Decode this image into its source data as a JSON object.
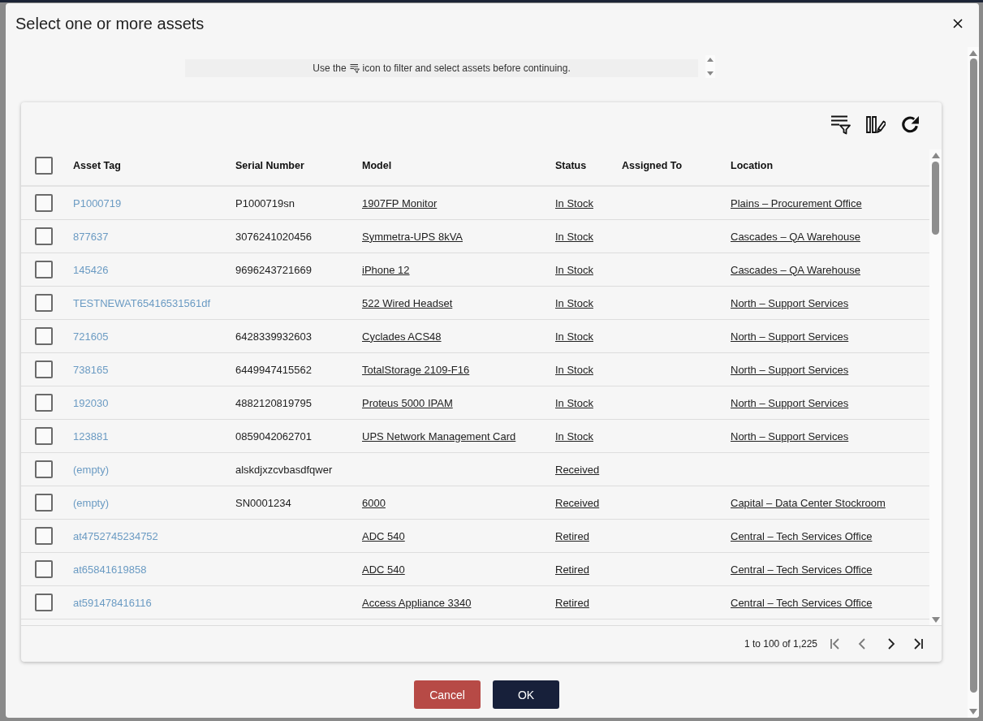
{
  "dialog": {
    "title": "Select one or more assets"
  },
  "info": {
    "text_before": "Use the",
    "text_after": "icon to filter and select assets before continuing."
  },
  "table": {
    "select_all": {
      "checked": false
    },
    "columns": [
      "Asset Tag",
      "Serial Number",
      "Model",
      "Status",
      "Assigned To",
      "Location"
    ],
    "rows": [
      {
        "checked": false,
        "asset_tag": "P1000719",
        "serial_number": "P1000719sn",
        "model": "1907FP Monitor",
        "status": "In Stock",
        "location": "Plains – Procurement Office"
      },
      {
        "checked": false,
        "asset_tag": "877637",
        "serial_number": "3076241020456",
        "model": "Symmetra-UPS 8kVA",
        "status": "In Stock",
        "location": "Cascades – QA Warehouse"
      },
      {
        "checked": false,
        "asset_tag": "145426",
        "serial_number": "9696243721669",
        "model": "iPhone 12",
        "status": "In Stock",
        "location": "Cascades – QA Warehouse"
      },
      {
        "checked": false,
        "asset_tag": "TESTNEWAT65416531561df",
        "model": "522 Wired Headset",
        "status": "In Stock",
        "location": "North – Support Services"
      },
      {
        "checked": false,
        "asset_tag": "721605",
        "serial_number": "6428339932603",
        "model": "Cyclades ACS48",
        "status": "In Stock",
        "location": "North – Support Services"
      },
      {
        "checked": false,
        "asset_tag": "738165",
        "serial_number": "6449947415562",
        "model": "TotalStorage 2109-F16",
        "status": "In Stock",
        "location": "North – Support Services"
      },
      {
        "checked": false,
        "asset_tag": "192030",
        "serial_number": "4882120819795",
        "model": "Proteus 5000 IPAM",
        "status": "In Stock",
        "location": "North – Support Services"
      },
      {
        "checked": false,
        "asset_tag": "123881",
        "serial_number": "0859042062701",
        "model": "UPS Network Management Card",
        "status": "In Stock",
        "location": "North – Support Services"
      },
      {
        "checked": false,
        "asset_tag": "(empty)",
        "serial_number": "alskdjxzcvbasdfqwer",
        "status": "Received"
      },
      {
        "checked": false,
        "asset_tag": "(empty)",
        "serial_number": "SN0001234",
        "model": "6000",
        "status": "Received",
        "location": "Capital – Data Center Stockroom"
      },
      {
        "checked": false,
        "asset_tag": "at4752745234752",
        "model": "ADC 540",
        "status": "Retired",
        "location": "Central – Tech Services Office"
      },
      {
        "checked": false,
        "asset_tag": "at65841619858",
        "model": "ADC 540",
        "status": "Retired",
        "location": "Central – Tech Services Office"
      },
      {
        "checked": false,
        "asset_tag": "at591478416116",
        "model": "Access Appliance 3340",
        "status": "Retired",
        "location": "Central – Tech Services Office"
      }
    ]
  },
  "pagination": {
    "range": "1 to 100 of 1,225",
    "buttons": [
      {
        "kind": "first",
        "disabled": true
      },
      {
        "kind": "previous",
        "disabled": true
      },
      {
        "kind": "next",
        "disabled": false
      },
      {
        "kind": "last",
        "disabled": false
      }
    ]
  },
  "buttons": [
    {
      "label": "Cancel",
      "kind": "cancel"
    },
    {
      "label": "OK",
      "kind": "primary"
    }
  ]
}
